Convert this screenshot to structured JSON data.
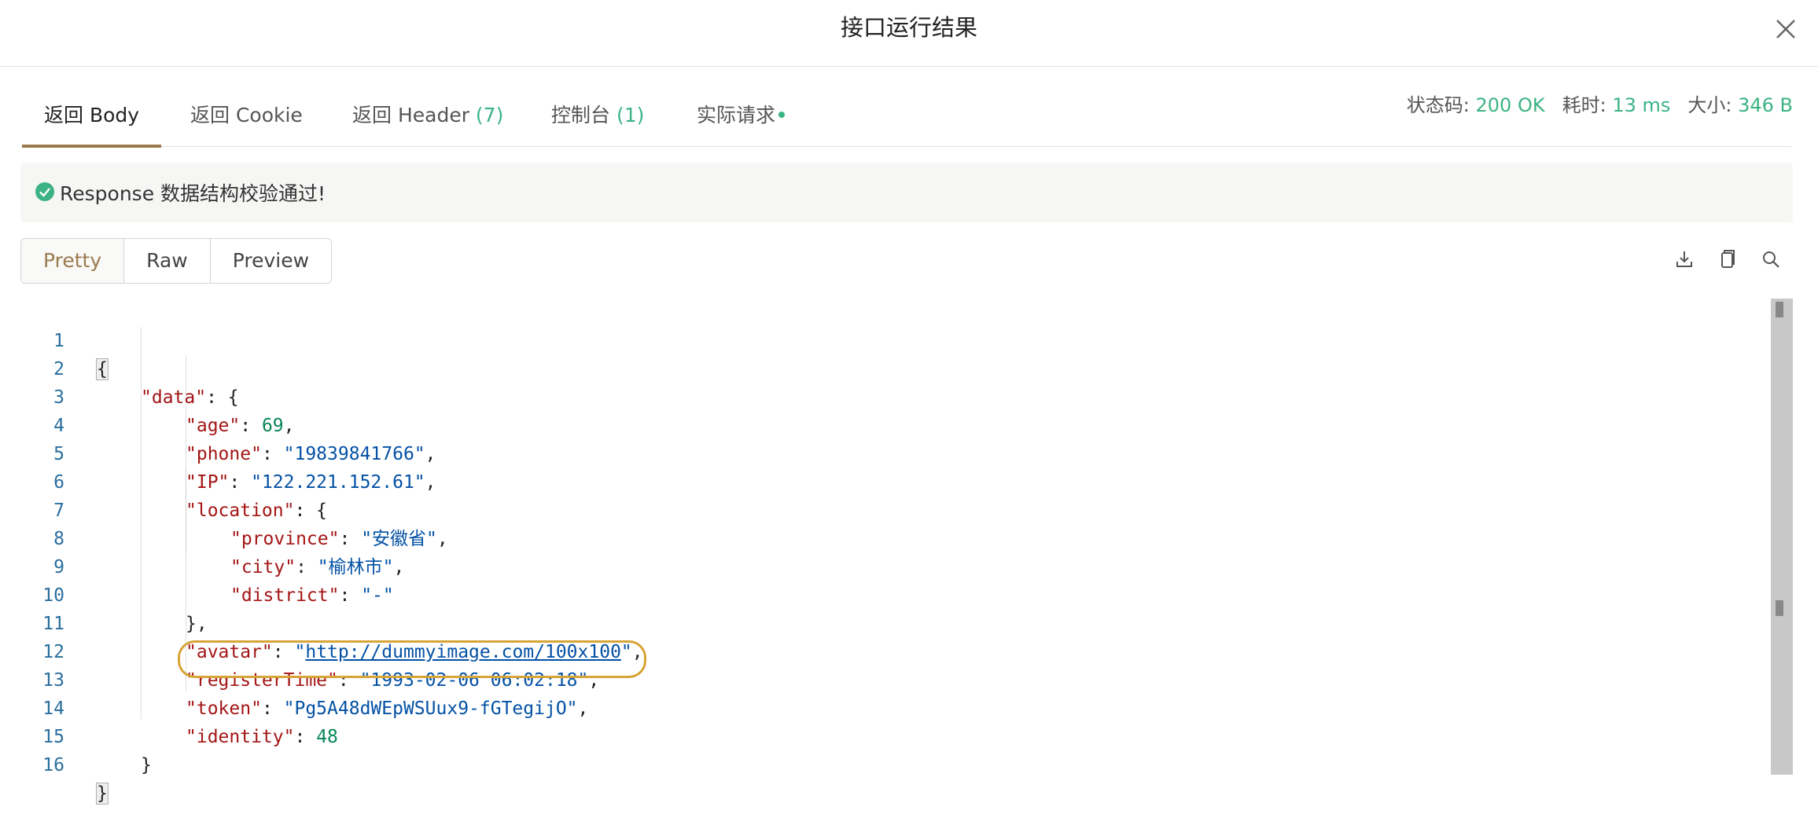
{
  "dialog": {
    "title": "接口运行结果"
  },
  "tabs": [
    {
      "label": "返回 Body",
      "count": "",
      "active": true
    },
    {
      "label": "返回 Cookie",
      "count": "",
      "active": false
    },
    {
      "label": "返回 Header ",
      "count": "(7)",
      "active": false
    },
    {
      "label": "控制台 ",
      "count": "(1)",
      "active": false
    },
    {
      "label": "实际请求",
      "count": "",
      "active": false
    }
  ],
  "status": {
    "code_label": "状态码: ",
    "code_value": "200 OK",
    "time_label": "耗时: ",
    "time_value": "13 ms",
    "size_label": "大小: ",
    "size_value": "346 B"
  },
  "validation": {
    "message": "Response 数据结构校验通过!"
  },
  "format": {
    "pretty": "Pretty",
    "raw": "Raw",
    "preview": "Preview"
  },
  "toolbar": {
    "download_icon": "download-icon",
    "copy_icon": "copy-icon",
    "search_icon": "search-icon"
  },
  "code": {
    "line_numbers": [
      "1",
      "2",
      "3",
      "4",
      "5",
      "6",
      "7",
      "8",
      "9",
      "10",
      "11",
      "12",
      "13",
      "14",
      "15",
      "16"
    ],
    "open_brace": "{",
    "close_brace": "}",
    "data_key": "\"data\"",
    "age_key": "\"age\"",
    "age_val": "69",
    "phone_key": "\"phone\"",
    "phone_val": "\"19839841766\"",
    "ip_key": "\"IP\"",
    "ip_val": "\"122.221.152.61\"",
    "location_key": "\"location\"",
    "province_key": "\"province\"",
    "province_val": "\"安徽省\"",
    "city_key": "\"city\"",
    "city_val": "\"榆林市\"",
    "district_key": "\"district\"",
    "district_val": "\"-\"",
    "avatar_key": "\"avatar\"",
    "avatar_q": "\"",
    "avatar_url": "http://dummyimage.com/100x100",
    "register_key": "\"registerTime\"",
    "register_val": "\"1993-02-06 06:02:18\"",
    "token_key": "\"token\"",
    "token_val": "\"Pg5A48dWEpWSUux9-fGTegijO\"",
    "identity_key": "\"identity\"",
    "identity_val": "48"
  },
  "colors": {
    "accent": "#9b7a4e",
    "success": "#3cb385",
    "highlight": "#d6a437"
  }
}
